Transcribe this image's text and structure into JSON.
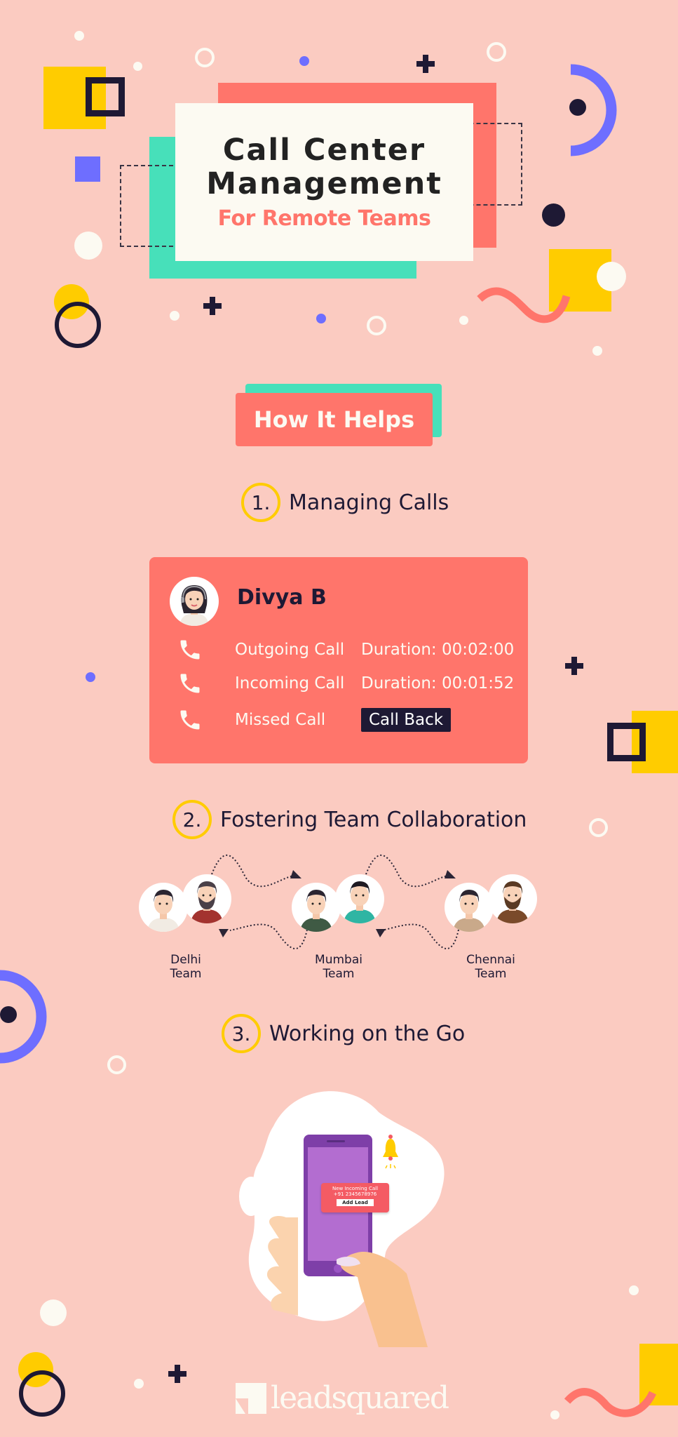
{
  "title": {
    "line1": "Call Center",
    "line2": "Management",
    "subtitle": "For Remote Teams"
  },
  "how_it_helps": {
    "label": "How It Helps"
  },
  "sections": [
    {
      "number": "1.",
      "title": "Managing Calls"
    },
    {
      "number": "2.",
      "title": "Fostering Team Collaboration"
    },
    {
      "number": "3.",
      "title": "Working on the Go"
    }
  ],
  "call_card": {
    "agent_name": "Divya B",
    "calls": [
      {
        "icon": "phone-icon",
        "label": "Outgoing Call",
        "detail": "Duration: 00:02:00"
      },
      {
        "icon": "phone-icon",
        "label": "Incoming Call",
        "detail": "Duration: 00:01:52"
      },
      {
        "icon": "phone-icon",
        "label": "Missed Call",
        "action": "Call Back"
      }
    ]
  },
  "teams": [
    {
      "line1": "Delhi",
      "line2": "Team"
    },
    {
      "line1": "Mumbai",
      "line2": "Team"
    },
    {
      "line1": "Chennai",
      "line2": "Team"
    }
  ],
  "phone_notification": {
    "title": "New Incoming Call",
    "number": "+91 2345678976",
    "button": "Add Lead"
  },
  "logo": {
    "text": "leadsquared"
  },
  "colors": {
    "background": "#FBCBC1",
    "coral": "#FF756B",
    "teal": "#47E0BA",
    "yellow": "#FFCC00",
    "purple": "#6E6EFF",
    "dark": "#1E1934",
    "cream": "#FCFAF2"
  }
}
